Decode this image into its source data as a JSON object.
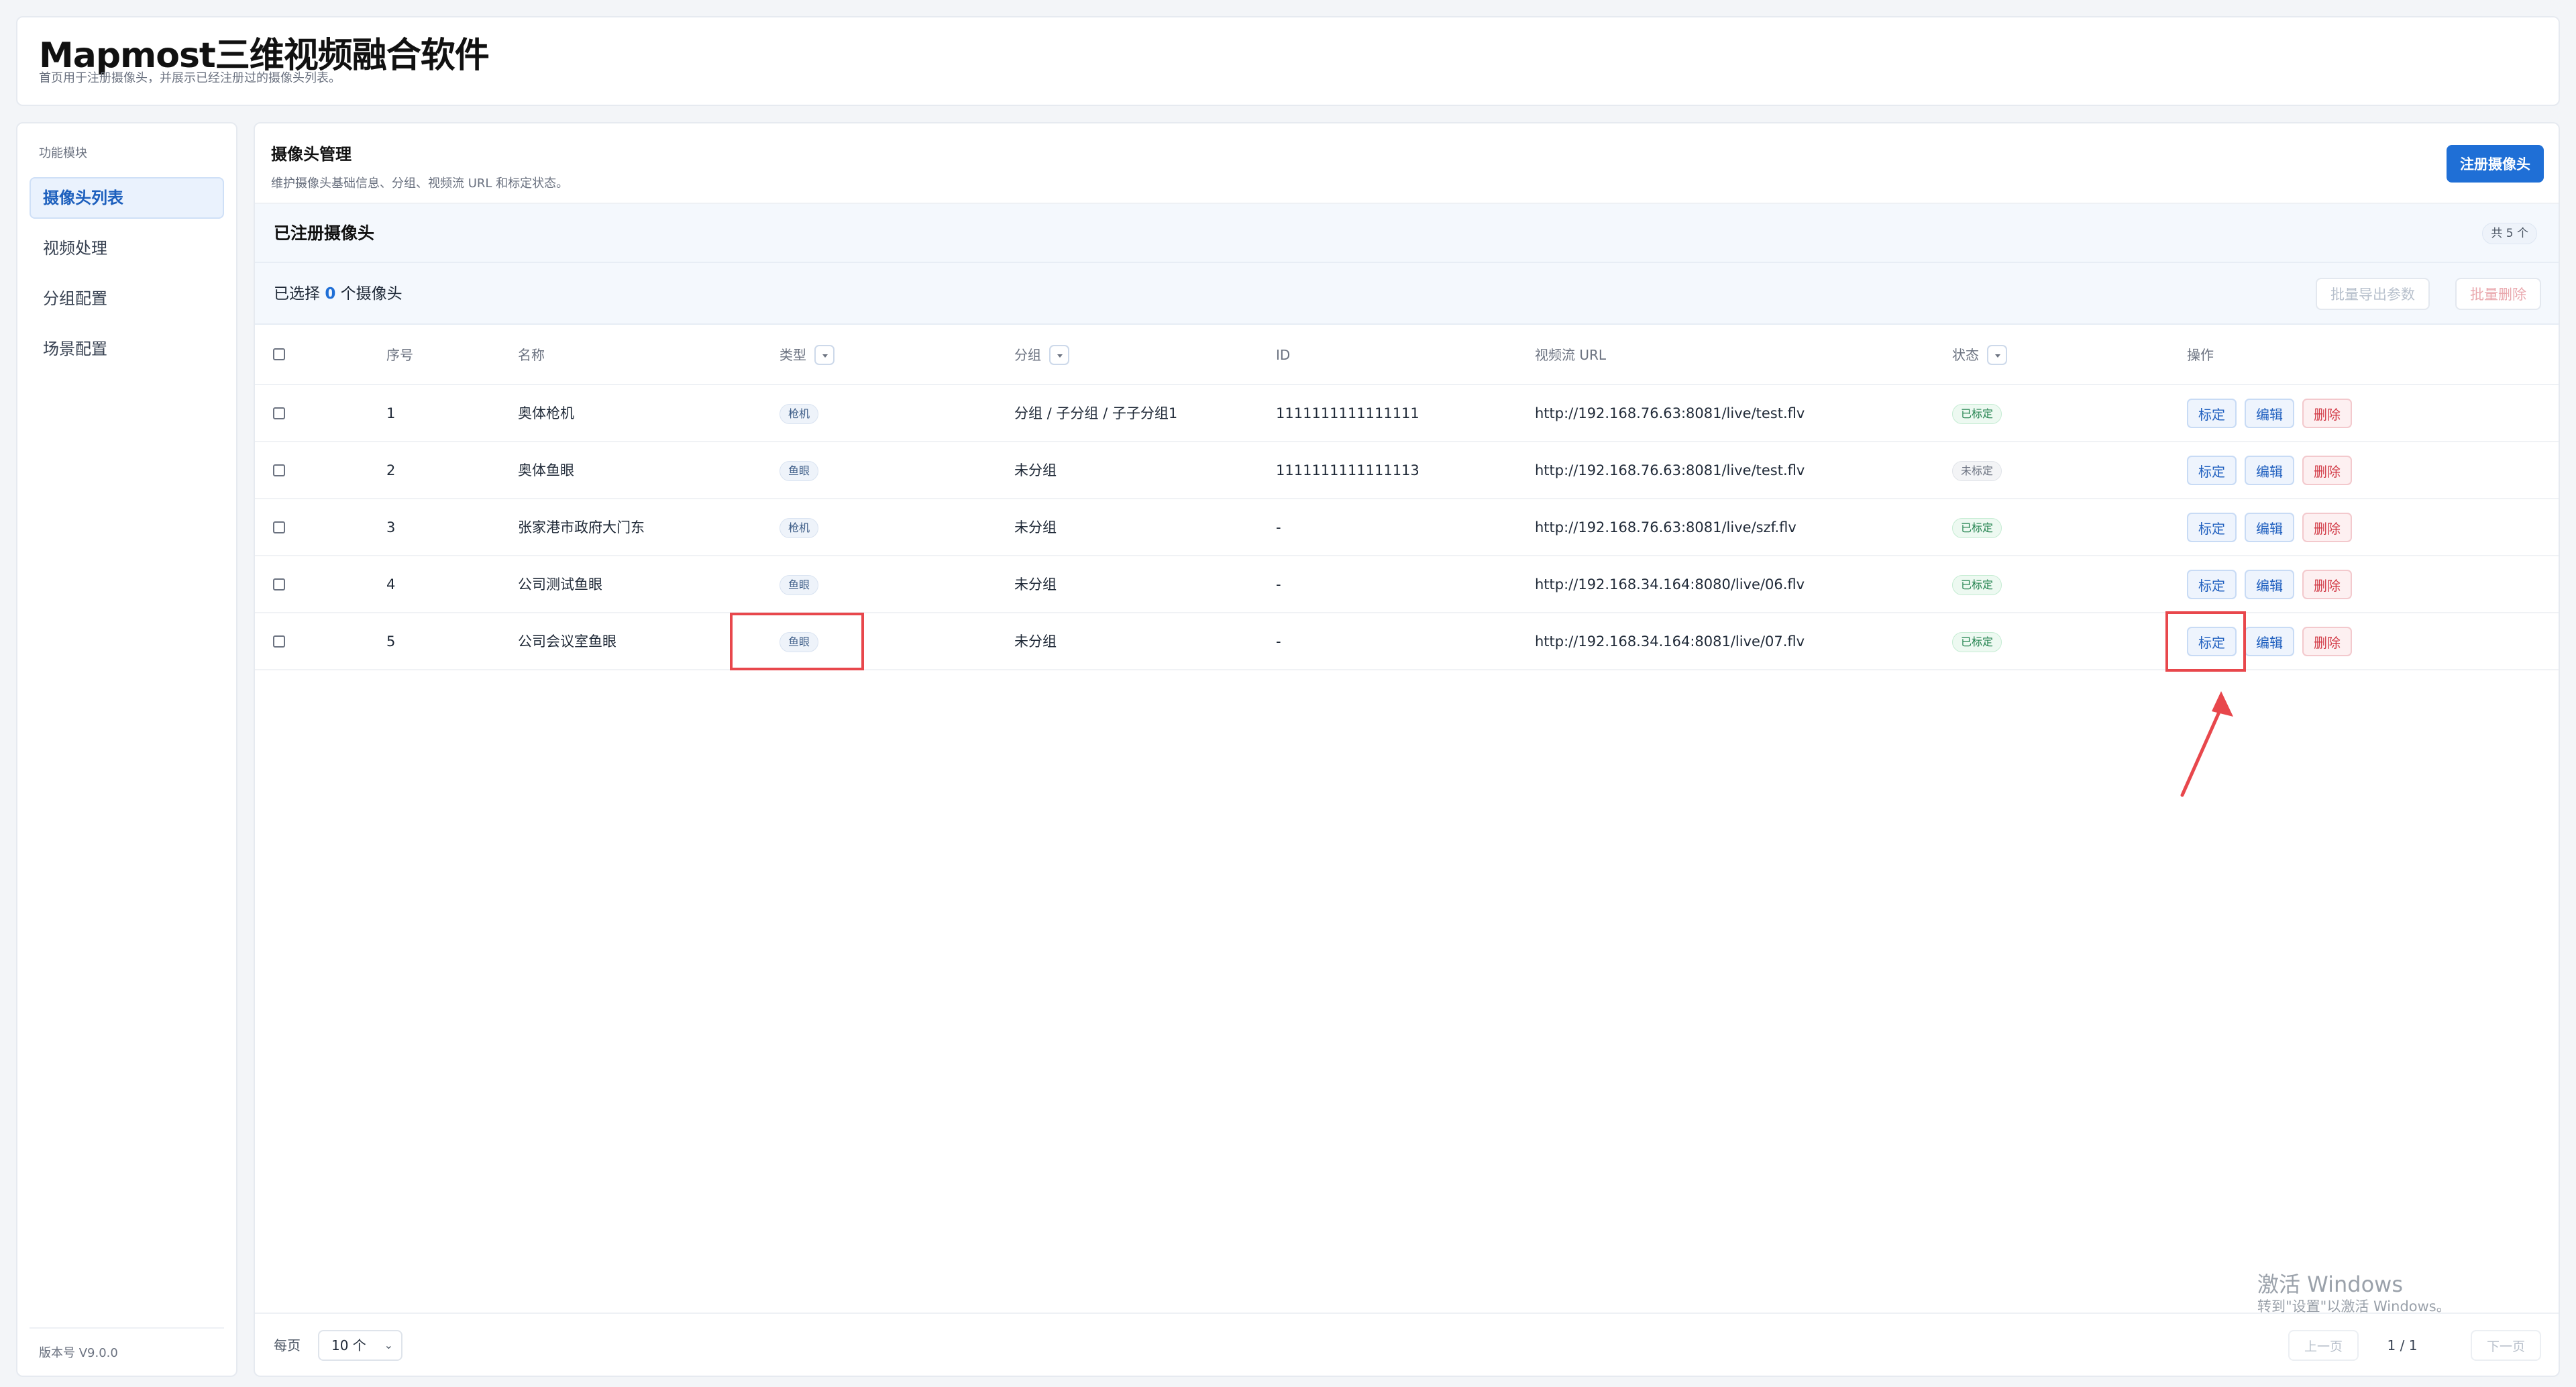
{
  "header": {
    "title": "Mapmost三维视频融合软件",
    "subtitle": "首页用于注册摄像头，并展示已经注册过的摄像头列表。"
  },
  "sidebar": {
    "heading": "功能模块",
    "items": [
      {
        "label": "摄像头列表",
        "active": true
      },
      {
        "label": "视频处理",
        "active": false
      },
      {
        "label": "分组配置",
        "active": false
      },
      {
        "label": "场景配置",
        "active": false
      }
    ],
    "version": "版本号 V9.0.0"
  },
  "main": {
    "title": "摄像头管理",
    "subtitle": "维护摄像头基础信息、分组、视频流 URL 和标定状态。",
    "register_button": "注册摄像头"
  },
  "card": {
    "title": "已注册摄像头",
    "count_badge": "共 5 个"
  },
  "selection": {
    "prefix": "已选择",
    "count": "0",
    "suffix": "个摄像头",
    "export_button": "批量导出参数",
    "delete_button": "批量删除"
  },
  "table": {
    "headers": {
      "index": "序号",
      "name": "名称",
      "type": "类型",
      "group": "分组",
      "id": "ID",
      "url": "视频流 URL",
      "status": "状态",
      "actions": "操作"
    },
    "action_labels": {
      "calibrate": "标定",
      "edit": "编辑",
      "delete": "删除"
    },
    "rows": [
      {
        "index": "1",
        "name": "奥体枪机",
        "type": "枪机",
        "group": "分组 / 子分组 / 子子分组1",
        "id": "1111111111111111",
        "url": "http://192.168.76.63:8081/live/test.flv",
        "status": "已标定",
        "calibrated": true
      },
      {
        "index": "2",
        "name": "奥体鱼眼",
        "type": "鱼眼",
        "group": "未分组",
        "id": "1111111111111113",
        "url": "http://192.168.76.63:8081/live/test.flv",
        "status": "未标定",
        "calibrated": false
      },
      {
        "index": "3",
        "name": "张家港市政府大门东",
        "type": "枪机",
        "group": "未分组",
        "id": "-",
        "url": "http://192.168.76.63:8081/live/szf.flv",
        "status": "已标定",
        "calibrated": true
      },
      {
        "index": "4",
        "name": "公司测试鱼眼",
        "type": "鱼眼",
        "group": "未分组",
        "id": "-",
        "url": "http://192.168.34.164:8080/live/06.flv",
        "status": "已标定",
        "calibrated": true
      },
      {
        "index": "5",
        "name": "公司会议室鱼眼",
        "type": "鱼眼",
        "group": "未分组",
        "id": "-",
        "url": "http://192.168.34.164:8081/live/07.flv",
        "status": "已标定",
        "calibrated": true
      }
    ]
  },
  "pagination": {
    "per_page_label": "每页",
    "per_page_value": "10 个",
    "prev": "上一页",
    "page_info": "1 / 1",
    "next": "下一页"
  },
  "watermark": {
    "title": "激活 Windows",
    "subtitle": "转到\"设置\"以激活 Windows。"
  },
  "colors": {
    "primary": "#1f6fd6",
    "highlight": "#e8474c",
    "status_ok": "#23834f",
    "danger": "#d23b47"
  }
}
